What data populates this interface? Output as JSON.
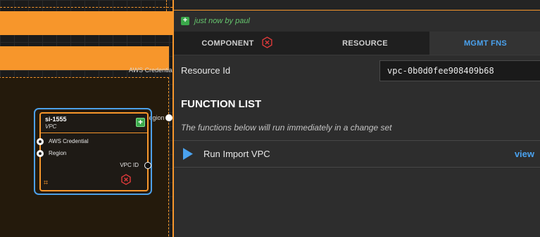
{
  "canvas": {
    "frame_labels": {
      "aws_credential": "AWS Credential",
      "region": "Region"
    },
    "node": {
      "title": "si-1555",
      "subtitle": "VPC",
      "inputs": [
        "AWS Credential",
        "Region"
      ],
      "output": "VPC ID",
      "add_icon": "plus-icon",
      "frame_icon": "frame-icon",
      "status_icon": "error-hexagon-icon"
    }
  },
  "panel": {
    "updated_text": "just now by paul",
    "tabs": [
      {
        "label": "COMPONENT",
        "icon": "error-hexagon-icon"
      },
      {
        "label": "RESOURCE"
      },
      {
        "label": "MGMT FNS",
        "active": true
      }
    ],
    "resource_id_label": "Resource Id",
    "resource_id_value": "vpc-0b0d0fee908409b68",
    "function_list_title": "FUNCTION LIST",
    "function_list_description": "The functions below will run immediately in a change set",
    "functions": [
      {
        "name": "Run Import VPC",
        "action": "view"
      }
    ]
  },
  "colors": {
    "accent": "#f7962b",
    "selection": "#4ca0ea",
    "link": "#4aa2ef",
    "success": "#3aa84a",
    "error": "#e03a3a"
  }
}
